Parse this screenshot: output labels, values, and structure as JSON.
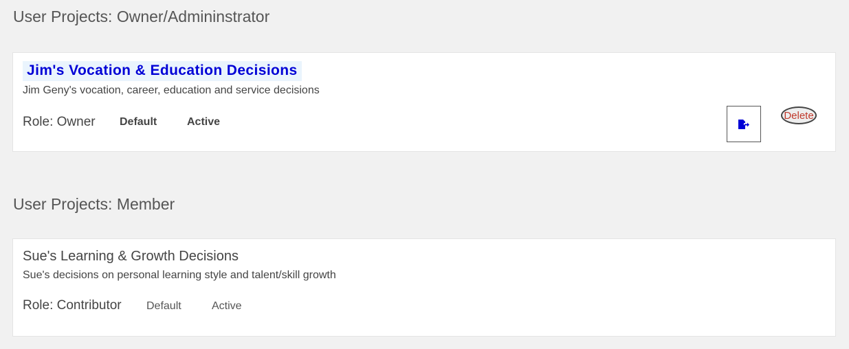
{
  "sections": {
    "owner": {
      "heading": "User Projects: Owner/Admininstrator",
      "project": {
        "title": "Jim's Vocation & Education Decisions",
        "description": "Jim Geny's vocation, career, education and service decisions",
        "role": "Role: Owner",
        "default_tag": "Default",
        "status": "Active",
        "open_icon": "file-export-icon",
        "delete_label": "Delete"
      }
    },
    "member": {
      "heading": "User Projects: Member",
      "project": {
        "title": "Sue's Learning & Growth Decisions",
        "description": "Sue's decisions on personal learning style and talent/skill growth",
        "role": "Role: Contributor",
        "default_tag": "Default",
        "status": "Active"
      }
    }
  },
  "colors": {
    "page_bg": "#f1f1f1",
    "title_link": "#0000d6",
    "title_highlight": "#eaf4fd",
    "delete_text": "#c0392b"
  }
}
